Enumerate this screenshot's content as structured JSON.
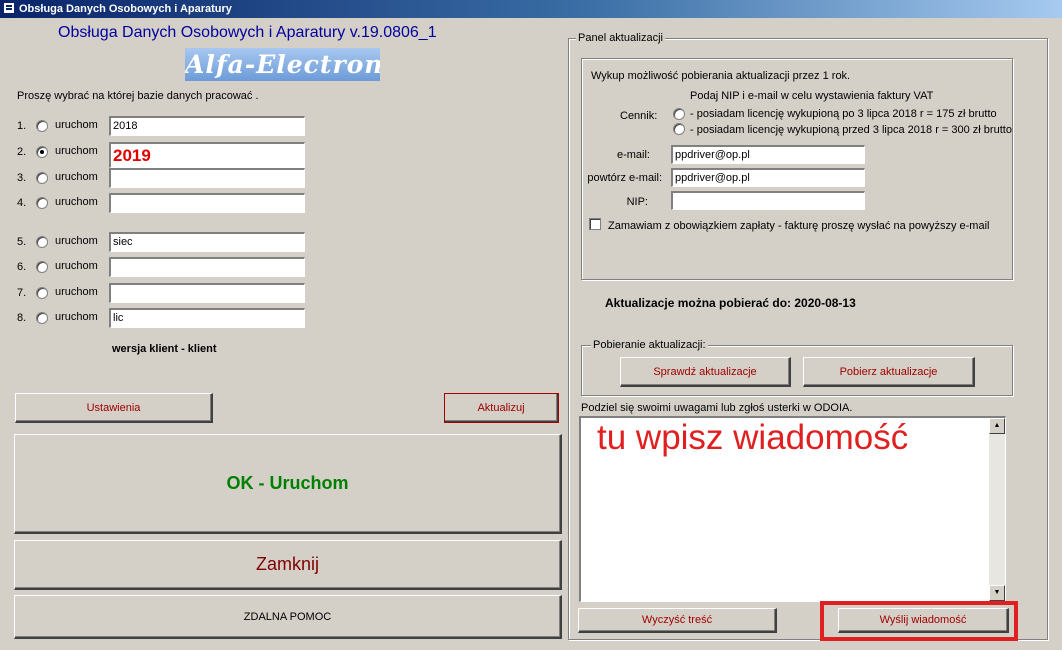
{
  "window": {
    "title": "Obsługa Danych Osobowych i Aparatury"
  },
  "app": {
    "heading": "Obsługa Danych Osobowych i Aparatury v.19.0806_1",
    "logo_text": "Alfa-Electronics"
  },
  "database": {
    "prompt": "Proszę wybrać na której bazie danych pracować .",
    "run_label": "uruchom",
    "selected_index": 1,
    "rows": [
      {
        "num": "1.",
        "value": "2018"
      },
      {
        "num": "2.",
        "value": "2019"
      },
      {
        "num": "3.",
        "value": ""
      },
      {
        "num": "4.",
        "value": ""
      },
      {
        "num": "5.",
        "value": "siec"
      },
      {
        "num": "6.",
        "value": ""
      },
      {
        "num": "7.",
        "value": ""
      },
      {
        "num": "8.",
        "value": "lic"
      }
    ],
    "version": "wersja klient - klient"
  },
  "buttons": {
    "settings": "Ustawienia",
    "update": "Aktualizuj",
    "ok_run": "OK - Uruchom",
    "close": "Zamknij",
    "remote_help": "ZDALNA POMOC"
  },
  "update_panel": {
    "title": "Panel aktualizacji",
    "purchase_info": "Wykup możliwość pobierania aktualizacji przez 1 rok.",
    "nip_info": "Podaj NIP i e-mail w celu wystawienia faktury  VAT",
    "price_label": "Cennik:",
    "price_option_1": "- posiadam  licencję wykupioną po 3 lipca 2018 r = 175 zł brutto",
    "price_option_2": "- posiadam licencję wykupioną przed 3 lipca 2018 r = 300 zł brutto",
    "email_label": "e-mail:",
    "email_value": "ppdriver@op.pl",
    "email_repeat_label": "powtórz e-mail:",
    "email_repeat_value": "ppdriver@op.pl",
    "nip_label": "NIP:",
    "nip_value": "",
    "order_checkbox_label": "Zamawiam z obowiązkiem zapłaty - fakturę proszę wysłać na powyższy  e-mail",
    "valid_until": "Aktualizacje można pobierać do: 2020-08-13",
    "download_group_title": "Pobieranie aktualizacji:",
    "check_updates": "Sprawdź aktualizacje",
    "download_updates": "Pobierz aktualizacje"
  },
  "feedback": {
    "label": "Podziel się swoimi uwagami lub zgłoś usterki w ODOIA.",
    "message_text": "tu wpisz wiadomość",
    "clear_button": "Wyczyść treść",
    "send_button": "Wyślij wiadomość",
    "highlight_color": "#e02020"
  }
}
